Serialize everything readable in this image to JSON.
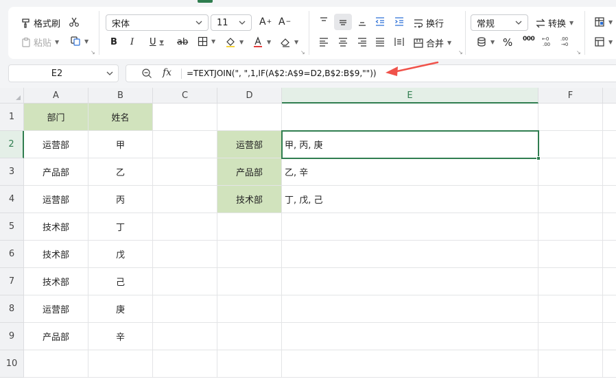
{
  "ribbon": {
    "format_painter": "格式刷",
    "paste": "粘贴",
    "font_name": "宋体",
    "font_size": "11",
    "bold": "B",
    "italic": "I",
    "underline": "U",
    "strike": "ab",
    "increase_font": "A",
    "decrease_font": "A",
    "wrap": "换行",
    "merge": "合并",
    "number_format": "常规",
    "convert": "转换",
    "percent": "%",
    "thousands": "000"
  },
  "formula_bar": {
    "name_box": "E2",
    "fx_label": "fx",
    "formula": "=TEXTJOIN(\", \",1,IF(A$2:A$9=D2,B$2:B$9,\"\"))"
  },
  "grid": {
    "columns": [
      "A",
      "B",
      "C",
      "D",
      "E",
      "F"
    ],
    "rows": [
      "1",
      "2",
      "3",
      "4",
      "5",
      "6",
      "7",
      "8",
      "9",
      "10"
    ],
    "header_dept": "部门",
    "header_name": "姓名",
    "col_a": [
      "运营部",
      "产品部",
      "运营部",
      "技术部",
      "技术部",
      "技术部",
      "运营部",
      "产品部"
    ],
    "col_b": [
      "甲",
      "乙",
      "丙",
      "丁",
      "戊",
      "己",
      "庚",
      "辛"
    ],
    "col_d": [
      "运营部",
      "产品部",
      "技术部"
    ],
    "col_e": [
      "甲, 丙, 庚",
      "乙, 辛",
      "丁, 戊, 己"
    ],
    "active_cell": "E2"
  },
  "colors": {
    "accent": "#2f7d4f",
    "header_fill": "#d1e3bd",
    "arrow": "#f0524a"
  }
}
